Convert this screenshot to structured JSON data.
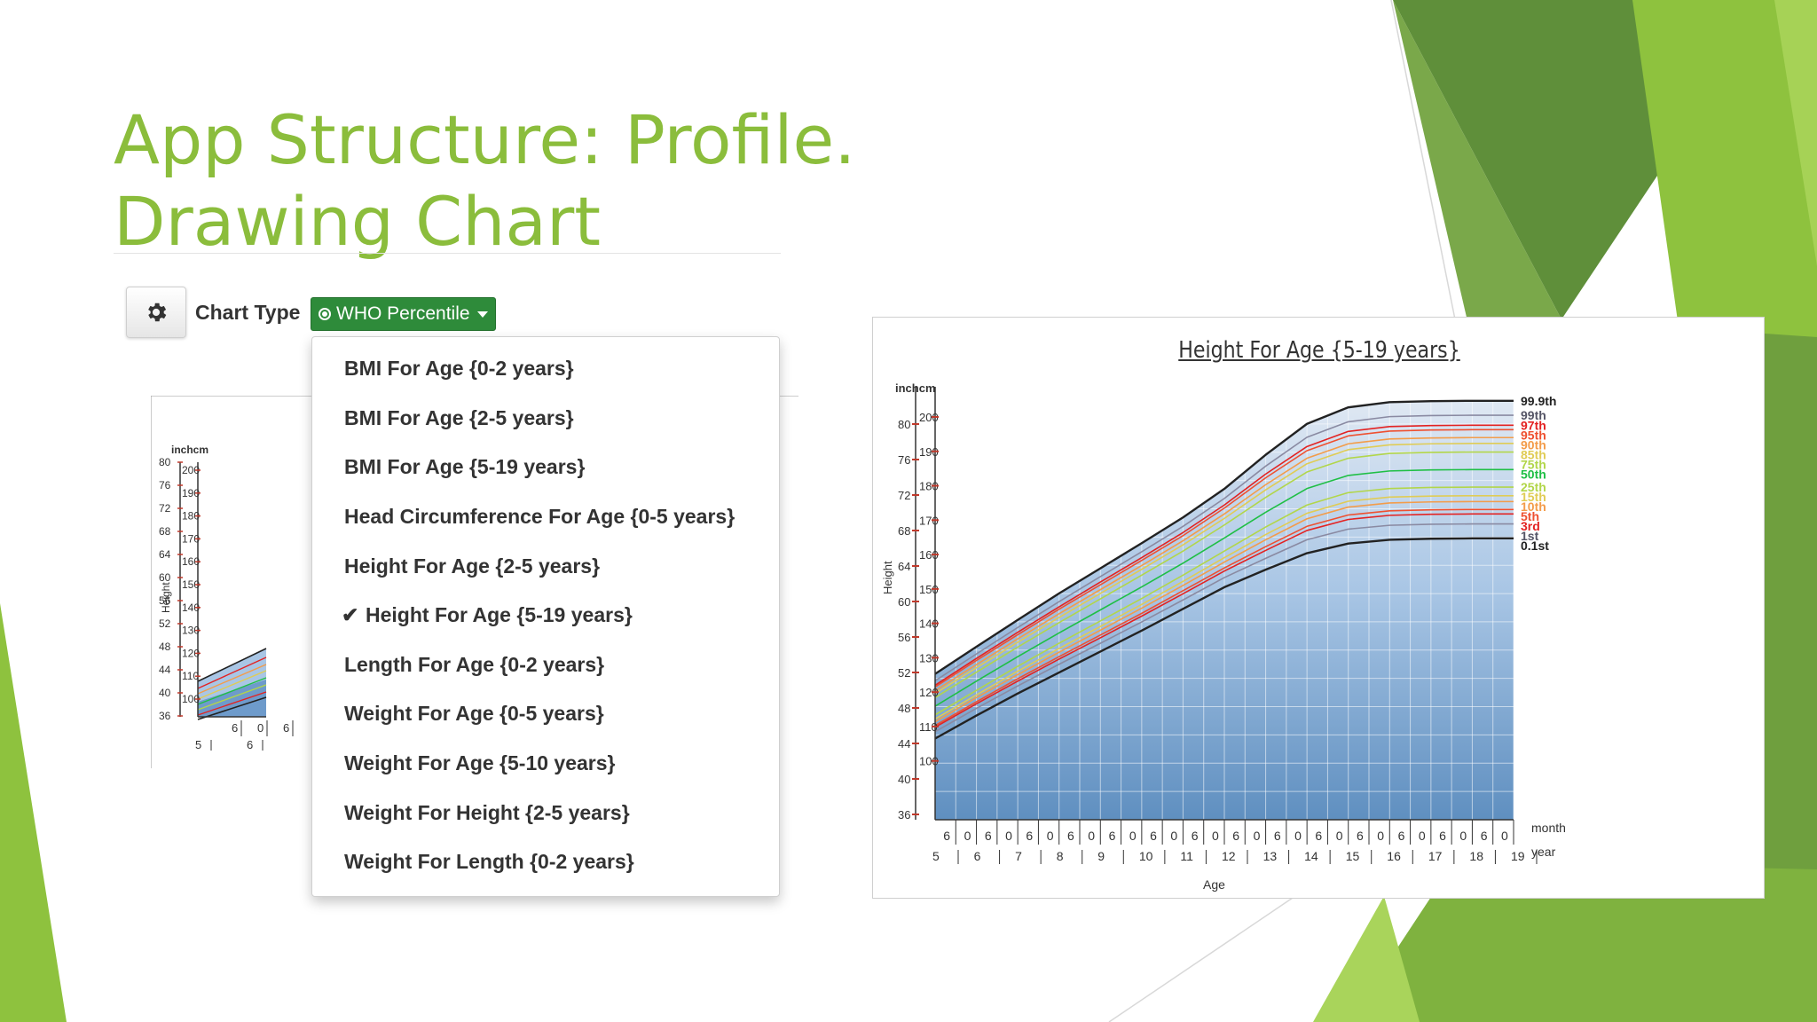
{
  "slide": {
    "title_line1": "App Structure: Profile.",
    "title_line2": "Drawing Chart",
    "accent_color": "#8bbd3c"
  },
  "toolbar": {
    "settings_icon": "gear-icon",
    "chart_type_label": "Chart Type",
    "chart_type_value": "WHO Percentile",
    "button_color": "#2e8b3a"
  },
  "dropdown": {
    "items": [
      {
        "label": "BMI For Age {0-2 years}",
        "selected": false
      },
      {
        "label": "BMI For Age {2-5 years}",
        "selected": false
      },
      {
        "label": "BMI For Age {5-19 years}",
        "selected": false
      },
      {
        "label": "Head Circumference For Age {0-5 years}",
        "selected": false
      },
      {
        "label": "Height For Age {2-5 years}",
        "selected": false
      },
      {
        "label": "Height For Age {5-19 years}",
        "selected": true
      },
      {
        "label": "Length For Age {0-2 years}",
        "selected": false
      },
      {
        "label": "Weight For Age {0-5 years}",
        "selected": false
      },
      {
        "label": "Weight For Age {5-10 years}",
        "selected": false
      },
      {
        "label": "Weight For Height {2-5 years}",
        "selected": false
      },
      {
        "label": "Weight For Length {0-2 years}",
        "selected": false
      }
    ]
  },
  "mini_chart": {
    "unit_label": "inchcm",
    "axis_label": "Height",
    "inch_ticks": [
      "80",
      "76",
      "72",
      "68",
      "64",
      "60",
      "56",
      "52",
      "48",
      "44",
      "40",
      "36"
    ],
    "cm_ticks": [
      "200",
      "190",
      "180",
      "170",
      "160",
      "150",
      "140",
      "130",
      "120",
      "110",
      "100"
    ],
    "month_ticks": [
      "6",
      "0",
      "6"
    ],
    "year_ticks": [
      "5",
      "6"
    ]
  },
  "chart_data": {
    "type": "line",
    "title": "Height For Age {5-19 years}",
    "xlabel": "Age",
    "ylabel": "Height",
    "y_unit_label": "inchcm",
    "x_unit_labels": [
      "month",
      "year"
    ],
    "xlim": [
      5,
      19
    ],
    "ylim_inch": [
      36,
      80
    ],
    "ylim_cm": [
      100,
      200
    ],
    "x": [
      5,
      6,
      7,
      8,
      9,
      10,
      11,
      12,
      13,
      14,
      15,
      16,
      17,
      18,
      19
    ],
    "series": [
      {
        "name": "99.9th",
        "color": "#222222",
        "values": [
          125.3,
          133.2,
          141.0,
          148.7,
          156.0,
          163.3,
          170.8,
          179.1,
          189.0,
          198.0,
          202.8,
          204.3,
          204.6,
          204.7,
          204.7
        ]
      },
      {
        "name": "99th",
        "color": "#8a8aa2",
        "values": [
          123.3,
          131.1,
          138.8,
          146.3,
          153.6,
          160.8,
          168.2,
          176.3,
          185.7,
          194.1,
          198.6,
          200.1,
          200.4,
          200.5,
          200.5
        ]
      },
      {
        "name": "97th",
        "color": "#e32222",
        "values": [
          122.0,
          129.8,
          137.4,
          144.8,
          152.0,
          159.1,
          166.4,
          174.4,
          183.4,
          191.4,
          195.8,
          197.2,
          197.5,
          197.6,
          197.6
        ]
      },
      {
        "name": "95th",
        "color": "#ee5030",
        "values": [
          121.5,
          129.2,
          136.7,
          144.1,
          151.2,
          158.3,
          165.5,
          173.5,
          182.3,
          190.2,
          194.5,
          195.9,
          196.2,
          196.3,
          196.3
        ]
      },
      {
        "name": "90th",
        "color": "#f39c4a",
        "values": [
          120.4,
          128.0,
          135.5,
          142.8,
          149.8,
          156.8,
          164.0,
          171.8,
          180.3,
          188.0,
          192.2,
          193.6,
          193.9,
          194.0,
          194.0
        ]
      },
      {
        "name": "85th",
        "color": "#e0cc55",
        "values": [
          119.6,
          127.1,
          134.5,
          141.7,
          148.7,
          155.7,
          162.8,
          170.5,
          178.8,
          186.4,
          190.5,
          191.9,
          192.2,
          192.3,
          192.3
        ]
      },
      {
        "name": "75th",
        "color": "#b2d64a",
        "values": [
          118.4,
          125.8,
          133.1,
          140.2,
          147.1,
          154.0,
          161.0,
          168.6,
          176.6,
          184.0,
          188.0,
          189.4,
          189.7,
          189.8,
          189.8
        ]
      },
      {
        "name": "50th",
        "color": "#1fbf45",
        "values": [
          115.9,
          123.2,
          130.3,
          137.2,
          143.9,
          150.6,
          157.5,
          164.8,
          172.3,
          179.2,
          183.0,
          184.3,
          184.6,
          184.7,
          184.7
        ]
      },
      {
        "name": "25th",
        "color": "#b2d64a",
        "values": [
          113.4,
          120.5,
          127.5,
          134.2,
          140.7,
          147.2,
          154.0,
          161.0,
          168.0,
          174.4,
          178.0,
          179.2,
          179.5,
          179.6,
          179.6
        ]
      },
      {
        "name": "15th",
        "color": "#e0cc55",
        "values": [
          112.2,
          119.2,
          126.1,
          132.7,
          139.1,
          145.5,
          152.2,
          159.1,
          165.8,
          172.0,
          175.5,
          176.7,
          177.0,
          177.1,
          177.1
        ]
      },
      {
        "name": "10th",
        "color": "#f39c4a",
        "values": [
          111.4,
          118.4,
          125.1,
          131.6,
          138.0,
          144.4,
          151.0,
          157.8,
          164.3,
          170.4,
          173.8,
          175.0,
          175.3,
          175.4,
          175.4
        ]
      },
      {
        "name": "5th",
        "color": "#ee5030",
        "values": [
          110.3,
          117.2,
          123.9,
          130.3,
          136.6,
          142.9,
          149.5,
          156.1,
          162.3,
          168.2,
          171.5,
          172.7,
          173.0,
          173.1,
          173.1
        ]
      },
      {
        "name": "3rd",
        "color": "#e32222",
        "values": [
          109.8,
          116.6,
          123.2,
          129.6,
          135.8,
          142.1,
          148.6,
          155.2,
          161.2,
          167.0,
          170.2,
          171.4,
          171.7,
          171.8,
          171.8
        ]
      },
      {
        "name": "1st",
        "color": "#8a8aa2",
        "values": [
          108.5,
          115.3,
          121.8,
          128.1,
          134.2,
          140.4,
          146.8,
          153.3,
          158.9,
          164.3,
          167.4,
          168.5,
          168.8,
          168.9,
          168.9
        ]
      },
      {
        "name": "0.1st",
        "color": "#222222",
        "values": [
          106.5,
          113.2,
          119.6,
          125.7,
          131.8,
          137.9,
          144.2,
          150.5,
          155.6,
          160.4,
          163.2,
          164.3,
          164.6,
          164.7,
          164.7
        ]
      }
    ],
    "y_ticks_inch": [
      "80",
      "76",
      "72",
      "68",
      "64",
      "60",
      "56",
      "52",
      "48",
      "44",
      "40",
      "36"
    ],
    "y_ticks_cm": [
      "200",
      "190",
      "180",
      "170",
      "160",
      "150",
      "140",
      "130",
      "120",
      "110",
      "100"
    ],
    "x_month_ticks": [
      "6",
      "0",
      "6",
      "0",
      "6",
      "0",
      "6",
      "0",
      "6",
      "0",
      "6",
      "0",
      "6",
      "0",
      "6",
      "0",
      "6",
      "0",
      "6",
      "0",
      "6",
      "0",
      "6",
      "0",
      "6",
      "0",
      "6",
      "0"
    ],
    "x_year_ticks": [
      "5",
      "6",
      "7",
      "8",
      "9",
      "10",
      "11",
      "12",
      "13",
      "14",
      "15",
      "16",
      "17",
      "18",
      "19"
    ],
    "grid": true,
    "legend": "right"
  }
}
